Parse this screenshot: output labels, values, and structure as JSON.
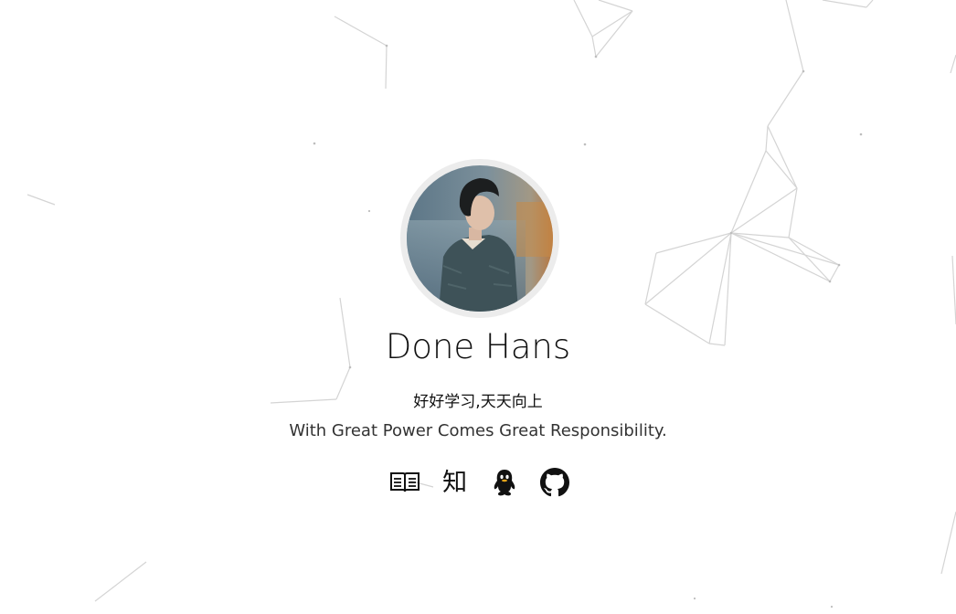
{
  "profile": {
    "name": "Done Hans",
    "motto": "好好学习,天天向上",
    "tagline": "With Great Power Comes Great Responsibility."
  },
  "social_links": [
    {
      "name": "blog",
      "icon": "book-icon"
    },
    {
      "name": "zhihu",
      "icon": "zhihu-icon",
      "glyph": "知"
    },
    {
      "name": "qq",
      "icon": "qq-penguin-icon"
    },
    {
      "name": "github",
      "icon": "github-icon"
    }
  ],
  "colors": {
    "background": "#ffffff",
    "text": "#111111",
    "network_lines": "#d8d8d8",
    "avatar_ring": "#ececec"
  }
}
